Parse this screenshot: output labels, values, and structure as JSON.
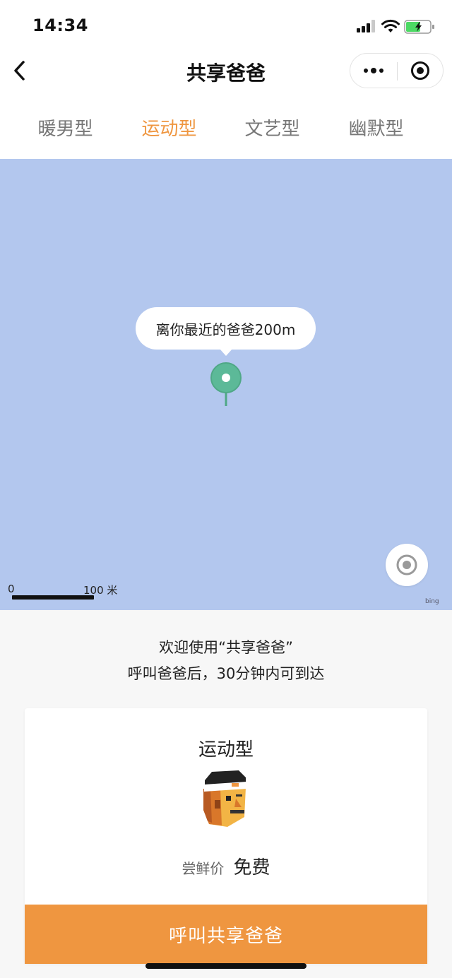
{
  "status_bar": {
    "time": "14:34"
  },
  "nav": {
    "title": "共享爸爸"
  },
  "tabs": [
    {
      "label": "暖男型"
    },
    {
      "label": "运动型"
    },
    {
      "label": "文艺型"
    },
    {
      "label": "幽默型"
    }
  ],
  "tabs_active_index": 1,
  "map": {
    "callout": "离你最近的爸爸200m",
    "scale_start": "0",
    "scale_end": "100 米",
    "attribution": "bing"
  },
  "welcome": {
    "line1": "欢迎使用“共享爸爸”",
    "line2": "呼叫爸爸后，30分钟内可到达"
  },
  "card": {
    "title": "运动型",
    "price_label": "尝鲜价",
    "price_value": "免费",
    "button_label": "呼叫共享爸爸"
  },
  "colors": {
    "accent": "#ef9640",
    "map_background": "#b3c7ee",
    "pin": "#5cb998",
    "battery_fill": "#4cd964"
  },
  "icons": {
    "back": "chevron-left-icon",
    "more": "more-dots-icon",
    "close": "capsule-close-icon",
    "pin": "map-pin-icon",
    "locate": "locate-icon",
    "avatar": "dad-avatar-icon"
  }
}
